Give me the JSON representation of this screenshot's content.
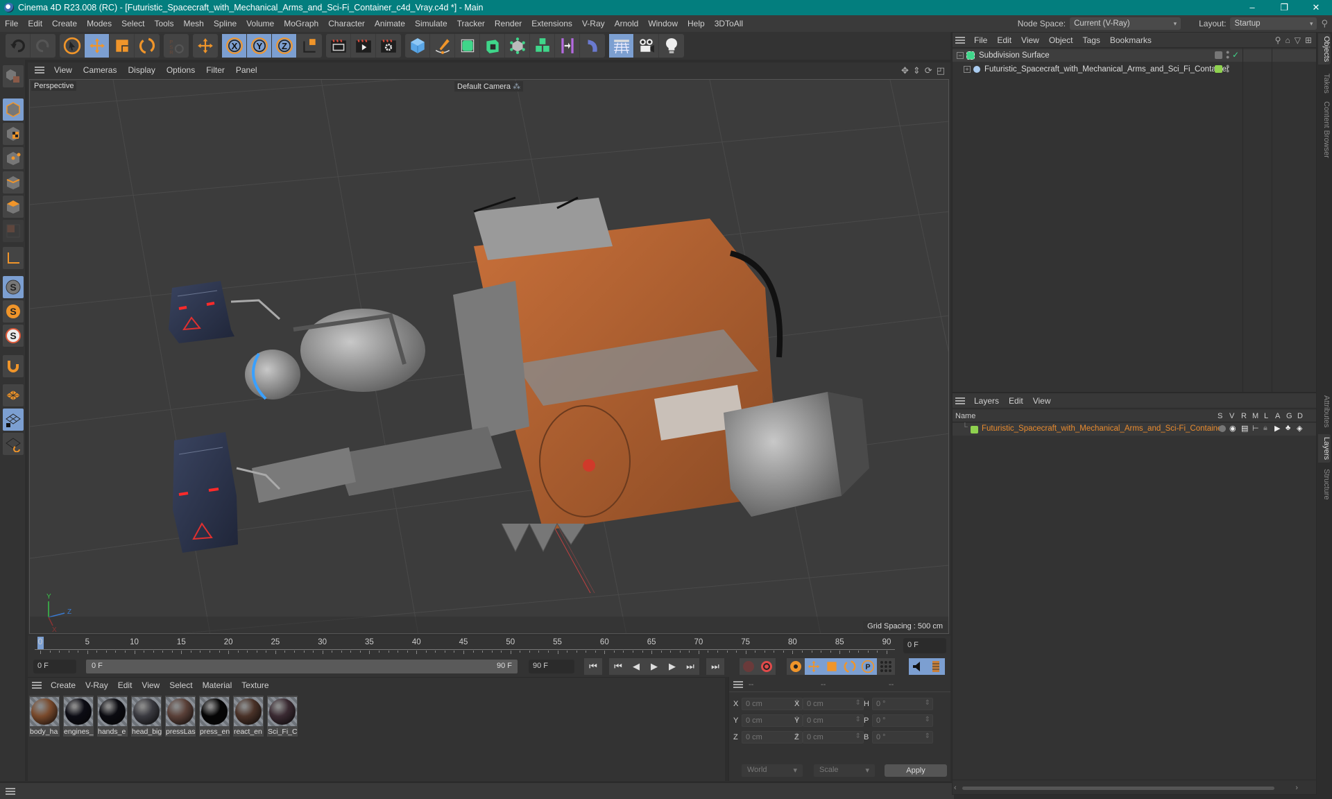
{
  "window": {
    "title": "Cinema 4D R23.008 (RC) - [Futuristic_Spacecraft_with_Mechanical_Arms_and_Sci-Fi_Container_c4d_Vray.c4d *] - Main",
    "controls": {
      "minimize": "–",
      "restore": "❐",
      "close": "✕"
    }
  },
  "menubar": {
    "items": [
      "File",
      "Edit",
      "Create",
      "Modes",
      "Select",
      "Tools",
      "Mesh",
      "Spline",
      "Volume",
      "MoGraph",
      "Character",
      "Animate",
      "Simulate",
      "Tracker",
      "Render",
      "Extensions",
      "V-Ray",
      "Arnold",
      "Window",
      "Help",
      "3DToAll"
    ],
    "node_space_label": "Node Space:",
    "node_space_value": "Current (V-Ray)",
    "layout_label": "Layout:",
    "layout_value": "Startup"
  },
  "toolbar": {
    "icons": [
      "undo-icon",
      "redo-icon",
      "live-selection-icon",
      "move-icon",
      "scale-icon",
      "rotate-icon",
      "psr-icon",
      "transform-icon",
      "x-axis-lock-icon",
      "y-axis-lock-icon",
      "z-axis-lock-icon",
      "coordinate-system-icon",
      "render-view-icon",
      "render-picture-viewer-icon",
      "render-settings-icon",
      "cube-icon",
      "pen-spline-icon",
      "subdivision-surface-icon",
      "extrude-icon",
      "cloner-icon",
      "array-icon",
      "symmetry-icon",
      "deformer-icon",
      "floor-icon",
      "camera-icon",
      "light-icon"
    ],
    "active": [
      "move-icon",
      "x-axis-lock-icon",
      "y-axis-lock-icon",
      "z-axis-lock-icon"
    ]
  },
  "left_tools": {
    "icons": [
      "make-editable-icon",
      "model-mode-icon",
      "texture-mode-icon",
      "points-mode-icon",
      "edges-mode-icon",
      "polygons-mode-icon",
      "uv-mode-icon",
      "axis-mode-icon",
      "solo-icon",
      "solo-selection-icon",
      "solo-hierarchy-icon",
      "snap-magnet-icon",
      "workplane-icon",
      "workplane-lock-icon",
      "workplane-align-icon"
    ]
  },
  "viewport": {
    "menu": [
      "View",
      "Cameras",
      "Display",
      "Options",
      "Filter",
      "Panel"
    ],
    "view_name": "Perspective",
    "camera_name": "Default Camera",
    "grid_spacing": "Grid Spacing : 500 cm",
    "axis_labels": {
      "x": "X",
      "y": "Y",
      "z": "Z"
    }
  },
  "timeline": {
    "ticks": [
      "0",
      "5",
      "10",
      "15",
      "20",
      "25",
      "30",
      "35",
      "40",
      "45",
      "50",
      "55",
      "60",
      "65",
      "70",
      "75",
      "80",
      "85",
      "90"
    ],
    "current_frame_field": "0 F",
    "start_field": "0 F",
    "range_start": "0 F",
    "range_end": "90 F",
    "end_field": "90 F",
    "current_frame": 0,
    "max_frame": 90
  },
  "materials": {
    "menu": [
      "Create",
      "V-Ray",
      "Edit",
      "View",
      "Select",
      "Material",
      "Texture"
    ],
    "items": [
      {
        "name": "body_ha",
        "color": "#7a4a2c"
      },
      {
        "name": "engines_",
        "color": "#0c0c14"
      },
      {
        "name": "hands_e",
        "color": "#0a0a10"
      },
      {
        "name": "head_big",
        "color": "#3a3a40"
      },
      {
        "name": "pressLas",
        "color": "#5a4038"
      },
      {
        "name": "press_en",
        "color": "#050505"
      },
      {
        "name": "react_en",
        "color": "#4a3228"
      },
      {
        "name": "Sci_Fi_Cc",
        "color": "#3a2a32"
      }
    ]
  },
  "coordinates": {
    "headers": [
      "--",
      "--",
      "--"
    ],
    "rows": [
      {
        "a1": "X",
        "v1": "0 cm",
        "a2": "X",
        "v2": "0 cm",
        "a3": "H",
        "v3": "0 °"
      },
      {
        "a1": "Y",
        "v1": "0 cm",
        "a2": "Y",
        "v2": "0 cm",
        "a3": "P",
        "v3": "0 °"
      },
      {
        "a1": "Z",
        "v1": "0 cm",
        "a2": "Z",
        "v2": "0 cm",
        "a3": "B",
        "v3": "0 °"
      }
    ],
    "space": "World",
    "mode": "Scale",
    "apply": "Apply"
  },
  "objects": {
    "menu": [
      "File",
      "Edit",
      "View",
      "Object",
      "Tags",
      "Bookmarks"
    ],
    "items": [
      {
        "name": "Subdivision Surface",
        "expander": "−"
      },
      {
        "name": "Futuristic_Spacecraft_with_Mechanical_Arms_and_Sci_Fi_Container",
        "expander": "+"
      }
    ]
  },
  "layers": {
    "menu": [
      "Layers",
      "Edit",
      "View"
    ],
    "columns": [
      "Name",
      "S",
      "V",
      "R",
      "M",
      "L",
      "A",
      "G",
      "D"
    ],
    "items": [
      {
        "name": "Futuristic_Spacecraft_with_Mechanical_Arms_and_Sci-Fi_Container",
        "color": "#8fd14f"
      }
    ]
  },
  "side_tabs": {
    "top": [
      "Objects",
      "Takes",
      "Content Browser"
    ],
    "bottom": [
      "Attributes",
      "Layers",
      "Structure"
    ]
  },
  "colors": {
    "title_bar": "#037e7e",
    "accent": "#7c9fd1",
    "tool_orange": "#f0952a",
    "layer_name": "#e98b2e",
    "layer_green": "#8fd14f"
  }
}
